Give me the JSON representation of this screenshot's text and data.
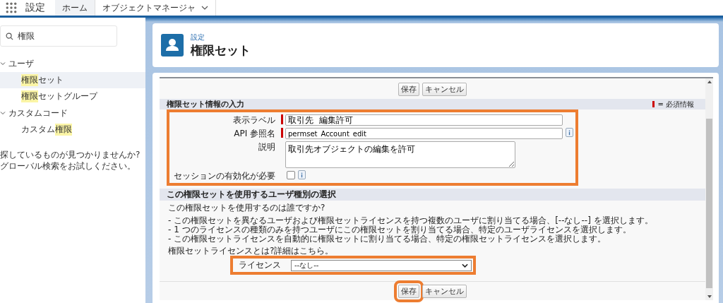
{
  "top_bar": {
    "app_name": "設定",
    "tabs": [
      {
        "label": "ホーム",
        "selected": true,
        "has_menu": false
      },
      {
        "label": "オブジェクトマネージャ",
        "selected": false,
        "has_menu": true
      }
    ]
  },
  "sidebar": {
    "search": {
      "value": "権限"
    },
    "tree": [
      {
        "parts": [
          {
            "text": "ユーザ",
            "highlight": false
          }
        ],
        "expanded": true,
        "selected": false,
        "children": [
          {
            "parts": [
              {
                "text": "権限",
                "highlight": true
              },
              {
                "text": "セット",
                "highlight": false
              }
            ],
            "selected": true
          },
          {
            "parts": [
              {
                "text": "権限",
                "highlight": true
              },
              {
                "text": "セットグループ",
                "highlight": false
              }
            ],
            "selected": false
          }
        ]
      },
      {
        "parts": [
          {
            "text": "カスタムコード",
            "highlight": false
          }
        ],
        "expanded": true,
        "selected": false,
        "children": [
          {
            "parts": [
              {
                "text": "カスタム",
                "highlight": false
              },
              {
                "text": "権限",
                "highlight": true
              }
            ],
            "selected": false
          }
        ]
      }
    ],
    "help_lines": [
      "探しているものが見つかりませんか?",
      "グローバル検索をお試しください。"
    ]
  },
  "header": {
    "breadcrumb": "設定",
    "title": "権限セット"
  },
  "form": {
    "top_buttons": [
      {
        "label": "保存",
        "highlighted": false
      },
      {
        "label": "キャンセル",
        "highlighted": false
      }
    ],
    "section1": {
      "title": "権限セット情報の入力",
      "required_legend": "= 必須情報",
      "highlighted": true,
      "fields": [
        {
          "kind": "text",
          "label": "表示ラベル",
          "value": "取引先  編集許可",
          "required": true,
          "info": false
        },
        {
          "kind": "text",
          "label": "API 参照名",
          "value": "permset_Account_edit",
          "required": true,
          "info": true
        },
        {
          "kind": "textarea",
          "label": "説明",
          "value": "取引先オブジェクトの編集を許可",
          "required": false,
          "info": false
        },
        {
          "kind": "checkbox",
          "label": "セッションの有効化が必要",
          "checked": false,
          "required": false,
          "info": true
        }
      ]
    },
    "section2": {
      "title": "この権限セットを使用するユーザ種別の選択",
      "question": "この権限セットを使用するのは誰ですか?",
      "bullets": [
        "- この権限セットを異なるユーザおよび権限セットライセンスを持つ複数のユーザに割り当てる場合、[--なし--] を選択します。",
        "- 1 つのライセンスの種類のみを持つユーザにこの権限セットを割り当てる場合、特定のユーザライセンスを選択します。",
        "- この権限セットライセンスを自動的に権限セットに割り当てる場合、特定の権限セットライセンスを選択します。"
      ],
      "more_text": "権限セットライセンスとは?",
      "more_link": "詳細はこちら。",
      "license": {
        "label": "ライセンス",
        "value": "--なし--",
        "highlighted": true
      }
    },
    "bottom_buttons": [
      {
        "label": "保存",
        "highlighted": true
      },
      {
        "label": "キャンセル",
        "highlighted": false
      }
    ]
  }
}
